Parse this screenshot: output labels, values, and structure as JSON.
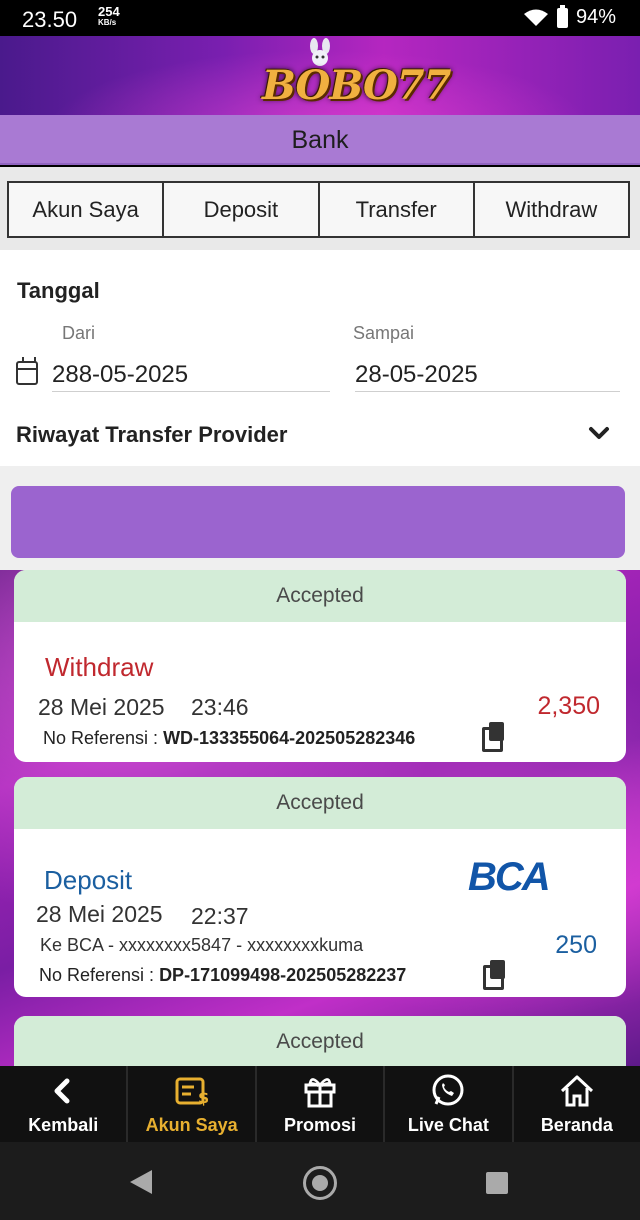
{
  "status_bar": {
    "time": "23.50",
    "speed_value": "254",
    "speed_unit": "KB/s",
    "battery": "94%"
  },
  "header": {
    "logo_text": "BOBO77"
  },
  "page": {
    "title": "Bank"
  },
  "tabs": [
    {
      "label": "Akun Saya"
    },
    {
      "label": "Deposit"
    },
    {
      "label": "Transfer"
    },
    {
      "label": "Withdraw"
    }
  ],
  "filter": {
    "tanggal_label": "Tanggal",
    "dari_label": "Dari",
    "sampai_label": "Sampai",
    "dari_value": "288-05-2025",
    "sampai_value": "28-05-2025",
    "history_type": "Riwayat Transfer Provider"
  },
  "transactions": [
    {
      "status": "Accepted",
      "type": "Withdraw",
      "date": "28 Mei 2025",
      "time": "23:46",
      "amount": "2,350",
      "ref_label": "No Referensi : ",
      "ref_value": "WD-133355064-202505282346"
    },
    {
      "status": "Accepted",
      "type": "Deposit",
      "date": "28 Mei 2025",
      "time": "22:37",
      "bank_logo": "BCA",
      "destination": "Ke BCA - xxxxxxxx5847 - xxxxxxxxkuma",
      "amount": "250",
      "ref_label": "No Referensi : ",
      "ref_value": "DP-171099498-202505282237"
    },
    {
      "status": "Accepted"
    }
  ],
  "bottom_nav": [
    {
      "label": "Kembali",
      "icon": "chevron-left-icon"
    },
    {
      "label": "Akun Saya",
      "icon": "wallet-icon"
    },
    {
      "label": "Promosi",
      "icon": "gift-icon"
    },
    {
      "label": "Live Chat",
      "icon": "whatsapp-icon"
    },
    {
      "label": "Beranda",
      "icon": "home-icon"
    }
  ],
  "colors": {
    "accent_purple": "#9b64cf",
    "status_accepted_bg": "#d3ecd7",
    "withdraw_red": "#c0282e",
    "deposit_blue": "#1b5fa0",
    "active_nav": "#e8b030"
  }
}
